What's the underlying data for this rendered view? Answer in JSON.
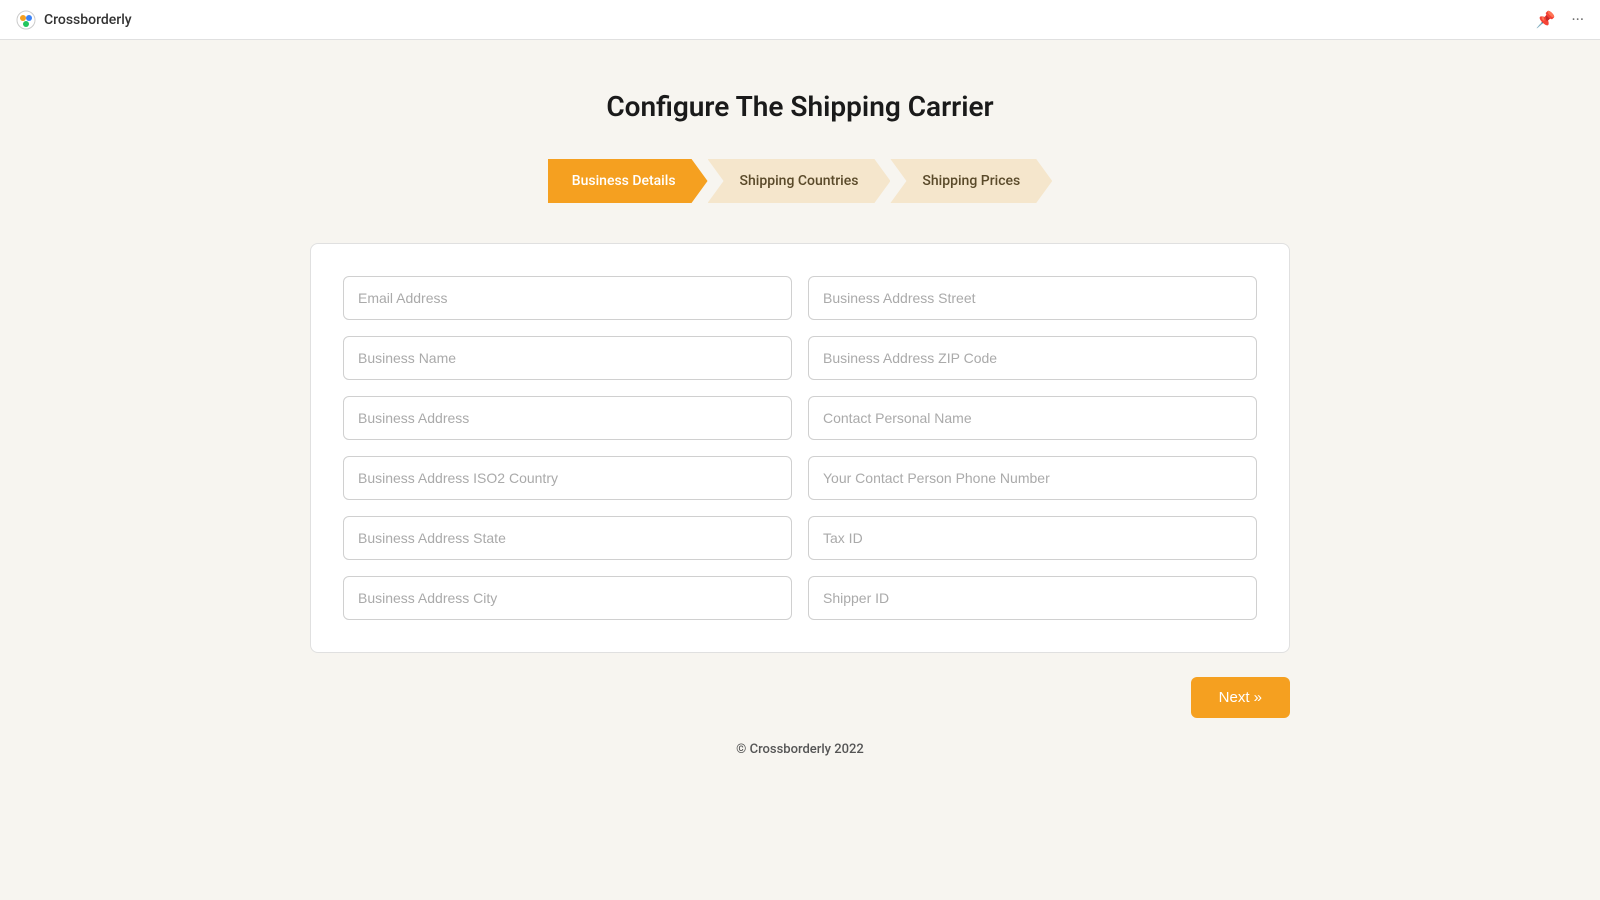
{
  "topbar": {
    "app_name": "Crossborderly",
    "pin_icon": "📌",
    "dots_icon": "···"
  },
  "page": {
    "title": "Configure The Shipping Carrier"
  },
  "stepper": {
    "steps": [
      {
        "id": "business-details",
        "label": "Business Details",
        "active": true
      },
      {
        "id": "shipping-countries",
        "label": "Shipping Countries",
        "active": false
      },
      {
        "id": "shipping-prices",
        "label": "Shipping Prices",
        "active": false
      }
    ]
  },
  "form": {
    "fields_left": [
      {
        "id": "email-address",
        "placeholder": "Email Address"
      },
      {
        "id": "business-name",
        "placeholder": "Business Name"
      },
      {
        "id": "business-address",
        "placeholder": "Business Address"
      },
      {
        "id": "business-address-iso2",
        "placeholder": "Business Address ISO2 Country"
      },
      {
        "id": "business-address-state",
        "placeholder": "Business Address State"
      },
      {
        "id": "business-address-city",
        "placeholder": "Business Address City"
      }
    ],
    "fields_right": [
      {
        "id": "business-address-street",
        "placeholder": "Business Address Street"
      },
      {
        "id": "business-address-zip",
        "placeholder": "Business Address ZIP Code"
      },
      {
        "id": "contact-personal-name",
        "placeholder": "Contact Personal Name"
      },
      {
        "id": "contact-phone",
        "placeholder": "Your Contact Person Phone Number"
      },
      {
        "id": "tax-id",
        "placeholder": "Tax ID"
      },
      {
        "id": "shipper-id",
        "placeholder": "Shipper ID"
      }
    ]
  },
  "buttons": {
    "next_label": "Next »"
  },
  "footer": {
    "text": "© Crossborderly 2022"
  }
}
